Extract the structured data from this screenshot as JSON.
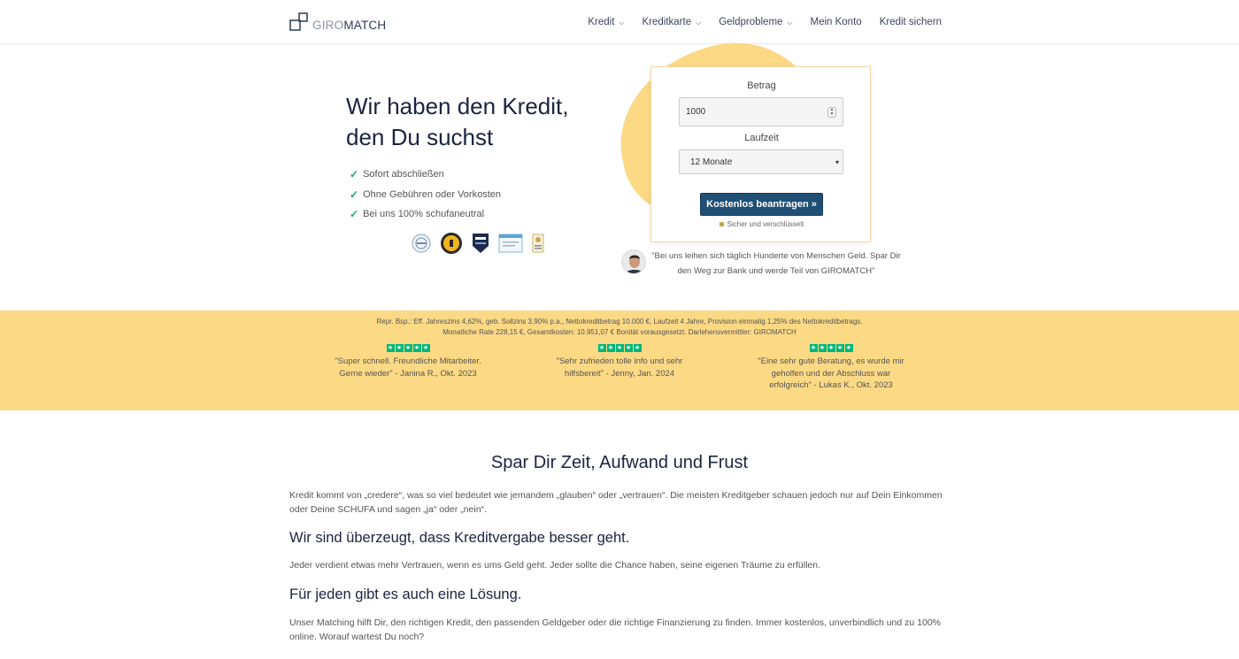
{
  "brand": {
    "logo_text_1": "GIRO",
    "logo_text_2": "MATCH",
    "accent": "#fbd985",
    "primary": "#1f4f74"
  },
  "nav": {
    "items": [
      {
        "label": "Kredit",
        "dropdown": true
      },
      {
        "label": "Kreditkarte",
        "dropdown": true
      },
      {
        "label": "Geldprobleme",
        "dropdown": true
      },
      {
        "label": "Mein Konto",
        "dropdown": false
      },
      {
        "label": "Kredit sichern",
        "dropdown": false
      }
    ]
  },
  "hero": {
    "title_line1": "Wir haben den Kredit,",
    "title_line2": "den Du suchst",
    "checks": [
      "Sofort abschließen",
      "Ohne Gebühren oder Vorkosten",
      "Bei uns 100% schufaneutral"
    ],
    "tick": "✓"
  },
  "form": {
    "amount_label": "Betrag",
    "amount_value": "1000",
    "term_label": "Laufzeit",
    "term_value": "12 Monate",
    "cta_label": "Kostenlos beantragen »",
    "secure_text": "Sicher und verschlüsselt"
  },
  "testimonial": {
    "quote": "\"Bei uns leihen sich täglich Hunderte von Menschen Geld. Spar Dir den Weg zur Bank und werde Teil von GIROMATCH\""
  },
  "band": {
    "repr_line1": "Repr. Bsp.: Eff. Jahreszins 4,62%, geb. Sollzins 3,90% p.a., Nettokreditbetrag 10.000 €, Laufzeit 4 Jahre, Provision einmalig 1,25% des Nettokreditbetrags.",
    "repr_line2": "Monatliche Rate 228,15 €, Gesamtkosten: 10.951,07 € Bonität vorausgesetzt. Darlehensvermittler: GIROMATCH",
    "reviews": [
      {
        "text": "\"Super schnell. Freundliche Mitarbeiter. Gerne wieder\" - Janina R., Okt. 2023",
        "stars": 5
      },
      {
        "text": "\"Sehr zufrieden tolle info und sehr hilfsbereit\" - Jenny, Jan. 2024",
        "stars": 5
      },
      {
        "text": "\"Eine sehr gute Beratung, es wurde mir geholfen und der Abschluss war erfolgreich\" - Lukas K., Okt. 2023",
        "stars": 5
      }
    ]
  },
  "content": {
    "heading": "Spar Dir Zeit, Aufwand und Frust",
    "para1": "Kredit kommt von „credere“, was so viel bedeutet wie jemandem „glauben“ oder „vertrauen“. Die meisten Kreditgeber schauen jedoch nur auf Dein Einkommen oder Deine SCHUFA und sagen „ja“ oder „nein“.",
    "heading2": "Wir sind überzeugt, dass Kreditvergabe besser geht.",
    "para2": "Jeder verdient etwas mehr Vertrauen, wenn es ums Geld geht. Jeder sollte die Chance haben, seine eigenen Träume zu erfüllen.",
    "heading3": "Für jeden gibt es auch eine Lösung.",
    "para3": "Unser Matching hilft Dir, den richtigen Kredit, den passenden Geldgeber oder die richtige Finanzierung zu finden. Immer kostenlos, unverbindlich und zu 100% online. Worauf wartest Du noch?"
  }
}
